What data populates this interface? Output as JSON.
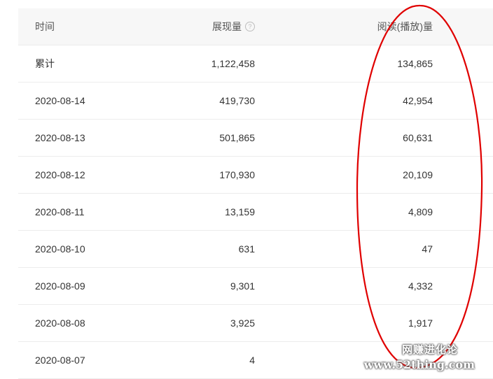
{
  "table": {
    "headers": {
      "date": "时间",
      "views": "展现量",
      "views_help": "?",
      "reads": "阅读(播放)量"
    },
    "rows": [
      {
        "date": "累计",
        "views": "1,122,458",
        "reads": "134,865"
      },
      {
        "date": "2020-08-14",
        "views": "419,730",
        "reads": "42,954"
      },
      {
        "date": "2020-08-13",
        "views": "501,865",
        "reads": "60,631"
      },
      {
        "date": "2020-08-12",
        "views": "170,930",
        "reads": "20,109"
      },
      {
        "date": "2020-08-11",
        "views": "13,159",
        "reads": "4,809"
      },
      {
        "date": "2020-08-10",
        "views": "631",
        "reads": "47"
      },
      {
        "date": "2020-08-09",
        "views": "9,301",
        "reads": "4,332"
      },
      {
        "date": "2020-08-08",
        "views": "3,925",
        "reads": "1,917"
      },
      {
        "date": "2020-08-07",
        "views": "4",
        "reads": ""
      }
    ]
  },
  "annotation": {
    "color": "#e00000",
    "shape": "ellipse"
  },
  "watermark": {
    "line1": "网赚进化论",
    "line2": "www.52thing.com"
  }
}
